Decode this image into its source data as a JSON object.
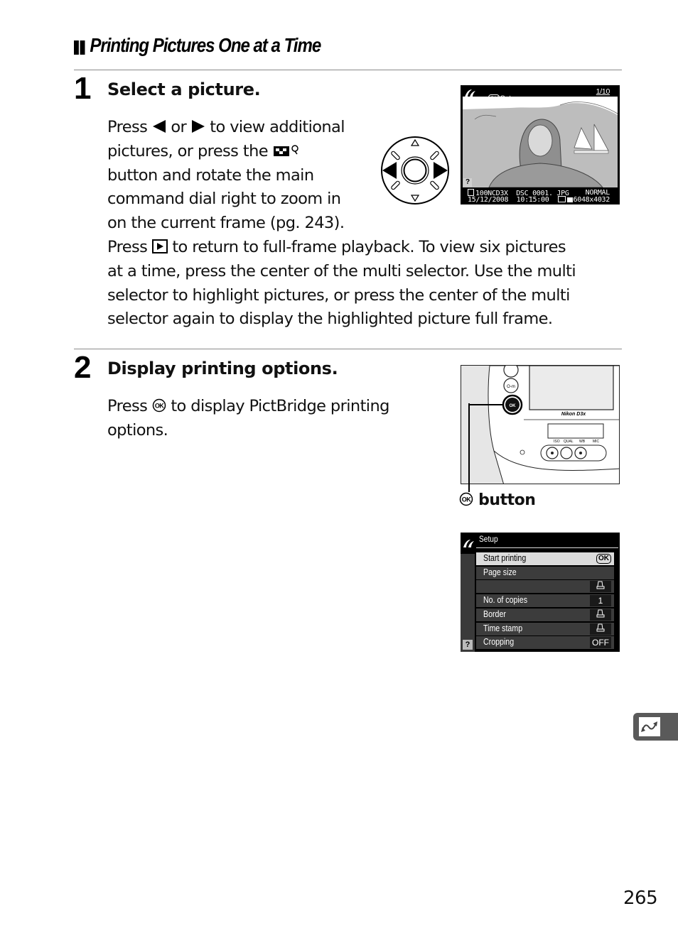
{
  "section": {
    "title": "Printing Pictures One at a Time"
  },
  "steps": [
    {
      "number": "1",
      "heading": "Select a picture.",
      "lines": [
        [
          "Press ",
          "{left}",
          " or ",
          "{right}",
          " to view additional"
        ],
        [
          "pictures, or press the ",
          "{thumb}"
        ],
        [
          "button and rotate the main"
        ],
        [
          "command dial right to zoom in"
        ],
        [
          "on the current frame (pg. 243)."
        ],
        [
          "Press ",
          "{play}",
          " to return to full-frame playback.  To view six pictures"
        ],
        [
          "at a time, press the center of the multi selector.  Use the multi"
        ],
        [
          "selector to highlight pictures, or press the center of the multi"
        ],
        [
          "selector again to display the highlighted picture full frame."
        ]
      ],
      "text": {
        "l1a": "Press ",
        "l1b": " or ",
        "l1c": " to view additional",
        "l2a": "pictures, or press the ",
        "l3": "button and rotate the main",
        "l4": "command dial right to zoom in",
        "l5": "on the current frame (pg. 243).",
        "l6a": "Press ",
        "l6b": " to return to full-frame playback.  To view six pictures",
        "l7": "at a time, press the center of the multi selector.  Use the multi",
        "l8": "selector to highlight pictures, or press the center of the multi",
        "l9": "selector again to display the highlighted picture full frame."
      },
      "icons": {
        "left": "left-arrow-icon",
        "right": "right-arrow-icon",
        "thumb": "thumbnail-zoom-out-icon",
        "play": "playback-icon"
      }
    },
    {
      "number": "2",
      "heading": "Display printing options.",
      "text": {
        "l1a": "Press ",
        "l1b": " to display PictBridge printing",
        "l2": "options."
      },
      "icons": {
        "ok": "ok-button-icon"
      }
    }
  ],
  "playback_screen": {
    "header_ok": "OK",
    "header_label": "Setup",
    "frame_counter": "1/10",
    "help": "?",
    "info_line1_left": "100NCD3X  DSC_0001. JPG",
    "info_line1_right": "NORMAL",
    "info_line2_left": "15/12/2008  10:15:00",
    "info_line2_right": "6048x4032"
  },
  "camera_illustration": {
    "brand": "Nikon D3x",
    "button_labels": [
      "ISO",
      "QUAL",
      "WB",
      "MIC"
    ],
    "ok_label": "OK",
    "caption_text": "button"
  },
  "setup_menu": {
    "title": "Setup",
    "help": "?",
    "rows": [
      {
        "label": "Start printing",
        "value": "OK",
        "selected": true
      },
      {
        "label": "Page size",
        "value": ""
      },
      {
        "label": "",
        "value": "printer-default-icon"
      },
      {
        "label": "No. of copies",
        "value": "1"
      },
      {
        "label": "Border",
        "value": "printer-default-icon"
      },
      {
        "label": "Time stamp",
        "value": "printer-default-icon"
      },
      {
        "label": "Cropping",
        "value": "OFF"
      }
    ]
  },
  "side_tab": {
    "icon": "connection-icon"
  },
  "page_number": "265"
}
